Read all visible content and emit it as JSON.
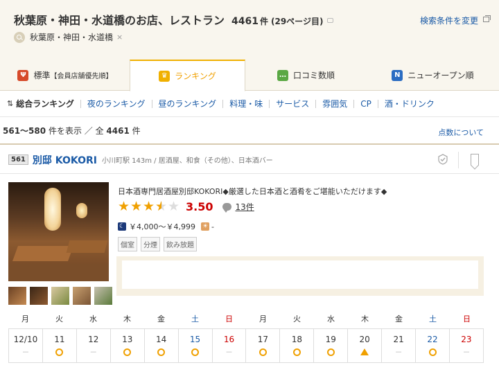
{
  "header": {
    "title": "秋葉原・神田・水道橋のお店、レストラン",
    "count": "4461",
    "count_unit": "件",
    "pages": "(29ページ目)",
    "search_conditions_link": "検索条件を変更",
    "area_chip": "秋葉原・神田・水道橋",
    "area_remove": "×"
  },
  "tabs": [
    {
      "label": "標準",
      "note": "【会員店舗優先順】",
      "icon": "fork-knife-icon",
      "icon_color": "#d64a2a"
    },
    {
      "label": "ランキング",
      "note": "",
      "icon": "crown-icon",
      "icon_color": "#f0b000"
    },
    {
      "label": "口コミ数順",
      "note": "",
      "icon": "chat-icon",
      "icon_color": "#5aa844"
    },
    {
      "label": "ニューオープン順",
      "note": "",
      "icon": "new-icon",
      "icon_color": "#2a6cc2"
    }
  ],
  "subnav": {
    "sort_icon": "⇅",
    "items": [
      "総合ランキング",
      "夜のランキング",
      "昼のランキング",
      "料理・味",
      "サービス",
      "雰囲気",
      "CP",
      "酒・ドリンク"
    ]
  },
  "results": {
    "range": "561～580",
    "range_suffix": "件を表示 ／ 全",
    "total": "4461",
    "total_suffix": "件",
    "about_points": "点数について"
  },
  "restaurant": {
    "rank": "561",
    "name": "別邸 KOKORI",
    "meta": "小川町駅 143m / 居酒屋、和食（その他）、日本酒バー",
    "catch": "日本酒専門居酒屋別邸KOKORI◆厳選した日本酒と酒肴をご堪能いただけます◆",
    "rating": 3.5,
    "score": "3.50",
    "reviews": "13件",
    "dinner_icon": "☾",
    "lunch_icon": "☀",
    "dinner_price": "￥4,000～￥4,999",
    "lunch_price": "-",
    "tags": [
      "個室",
      "分煙",
      "飲み放題"
    ],
    "accent_color": "#f0a000"
  },
  "calendar": {
    "days": [
      {
        "label": "月",
        "type": "weekday"
      },
      {
        "label": "火",
        "type": "weekday"
      },
      {
        "label": "水",
        "type": "weekday"
      },
      {
        "label": "木",
        "type": "weekday"
      },
      {
        "label": "金",
        "type": "weekday"
      },
      {
        "label": "土",
        "type": "sat"
      },
      {
        "label": "日",
        "type": "sun"
      },
      {
        "label": "月",
        "type": "weekday"
      },
      {
        "label": "火",
        "type": "weekday"
      },
      {
        "label": "水",
        "type": "weekday"
      },
      {
        "label": "木",
        "type": "weekday"
      },
      {
        "label": "金",
        "type": "weekday"
      },
      {
        "label": "土",
        "type": "sat"
      },
      {
        "label": "日",
        "type": "sun"
      }
    ],
    "dates": [
      {
        "date": "12/10",
        "mark": "dash",
        "type": "weekday"
      },
      {
        "date": "11",
        "mark": "circle",
        "type": "weekday"
      },
      {
        "date": "12",
        "mark": "dash",
        "type": "weekday"
      },
      {
        "date": "13",
        "mark": "circle",
        "type": "weekday"
      },
      {
        "date": "14",
        "mark": "circle",
        "type": "weekday"
      },
      {
        "date": "15",
        "mark": "circle",
        "type": "sat"
      },
      {
        "date": "16",
        "mark": "dash",
        "type": "sun"
      },
      {
        "date": "17",
        "mark": "circle",
        "type": "weekday"
      },
      {
        "date": "18",
        "mark": "circle",
        "type": "weekday"
      },
      {
        "date": "19",
        "mark": "circle",
        "type": "weekday"
      },
      {
        "date": "20",
        "mark": "triangle",
        "type": "weekday"
      },
      {
        "date": "21",
        "mark": "dash",
        "type": "weekday"
      },
      {
        "date": "22",
        "mark": "circle",
        "type": "sat"
      },
      {
        "date": "23",
        "mark": "dash",
        "type": "sun"
      }
    ],
    "dash_text": "－"
  }
}
